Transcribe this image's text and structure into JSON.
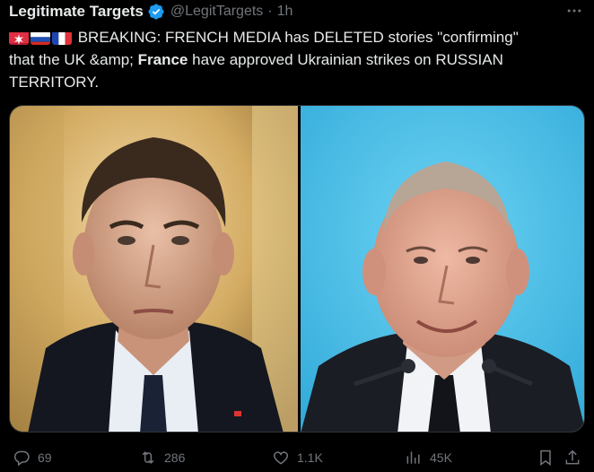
{
  "tweet": {
    "author_name": "Legitimate Targets",
    "handle": "@LegitTargets",
    "separator": "·",
    "time": "1h",
    "text_line1": " BREAKING: FRENCH MEDIA has DELETED stories \"confirming\"",
    "text_line2_prefix": "that the UK &amp; ",
    "text_line2_bold": "France",
    "text_line2_suffix": " have approved Ukrainian strikes on RUSSIAN",
    "text_line3": "TERRITORY.",
    "flags": [
      "siren-emoji",
      "russia-flag",
      "france-flag"
    ]
  },
  "media": {
    "left_photo": "man-in-dark-suit-gold-background",
    "right_photo": "smiling-man-blue-background-microphones"
  },
  "actions": {
    "replies": "69",
    "reposts": "286",
    "likes": "1.1K",
    "views": "45K"
  },
  "colors": {
    "background": "#000000",
    "text": "#e7e9ea",
    "muted": "#71767b",
    "verified": "#1d9bf0"
  }
}
